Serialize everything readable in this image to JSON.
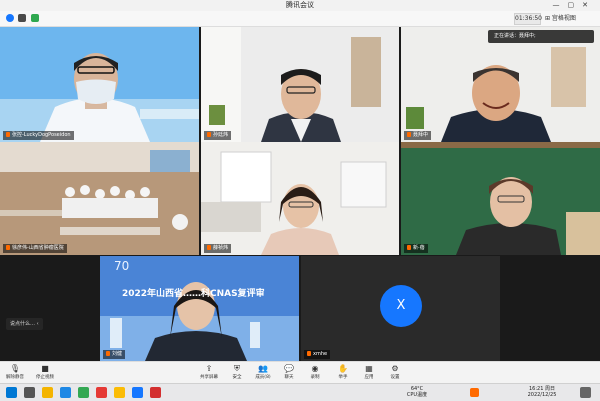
{
  "window": {
    "title": "腾讯会议"
  },
  "infobar": {
    "timer": "01:36:50",
    "view_label": "⊞ 宫格视图"
  },
  "speaking": {
    "label": "正在讲话：",
    "name": "聂拜中;"
  },
  "participants": [
    {
      "name": "张控-LuckyDogPoseidon"
    },
    {
      "name": "孙廷炜"
    },
    {
      "name": "聂拜中"
    },
    {
      "name": "徐彦伟-山西省肿瘤医院"
    },
    {
      "name": "薛祯炜"
    },
    {
      "name": "新·蓓"
    },
    {
      "name": "刘健"
    },
    {
      "name": "xmhe"
    }
  ],
  "slide": {
    "title": "2022年山西省……科CNAS复评审"
  },
  "avatar_tile": {
    "initial": "X"
  },
  "side_chip": {
    "label": "说点什么…"
  },
  "toolbar": {
    "mute": "解除静音",
    "video": "停止视频",
    "share": "共享屏幕",
    "security": "安全",
    "members": "成员(8)",
    "chat": "聊天",
    "record": "录制",
    "apps": "应用",
    "settings": "设置",
    "raise": "举手"
  },
  "taskbar": {
    "weather_temp": "64°C",
    "weather_label": "CPU温度",
    "time": "16:21 周日",
    "date": "2022/12/25"
  },
  "colors": {
    "accent": "#1677ff",
    "mic": "#ff6a00"
  }
}
